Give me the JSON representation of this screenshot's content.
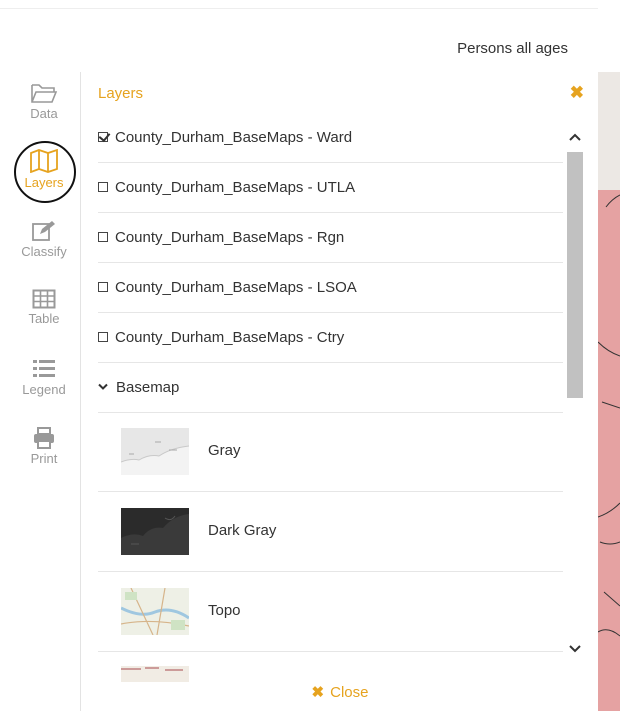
{
  "indicator": "Persons all ages",
  "sidebar": {
    "items": [
      {
        "label": "Data",
        "icon": "folder-icon"
      },
      {
        "label": "Layers",
        "icon": "map-icon",
        "active": true
      },
      {
        "label": "Classify",
        "icon": "edit-icon"
      },
      {
        "label": "Table",
        "icon": "table-icon"
      },
      {
        "label": "Legend",
        "icon": "list-icon"
      },
      {
        "label": "Print",
        "icon": "print-icon"
      }
    ]
  },
  "panel": {
    "title": "Layers",
    "close_icon": "✖",
    "layers": [
      {
        "label": "County_Durham_BaseMaps - Ward",
        "checked": true
      },
      {
        "label": "County_Durham_BaseMaps - UTLA",
        "checked": false
      },
      {
        "label": "County_Durham_BaseMaps - Rgn",
        "checked": false
      },
      {
        "label": "County_Durham_BaseMaps - LSOA",
        "checked": false
      },
      {
        "label": "County_Durham_BaseMaps - Ctry",
        "checked": false
      }
    ],
    "basemap_group": "Basemap",
    "basemaps": [
      {
        "label": "Gray"
      },
      {
        "label": "Dark Gray"
      },
      {
        "label": "Topo"
      }
    ],
    "footer_close": "Close",
    "footer_icon": "✖"
  },
  "colors": {
    "accent": "#e6a31f",
    "map_fill": "#e5a2a2"
  }
}
